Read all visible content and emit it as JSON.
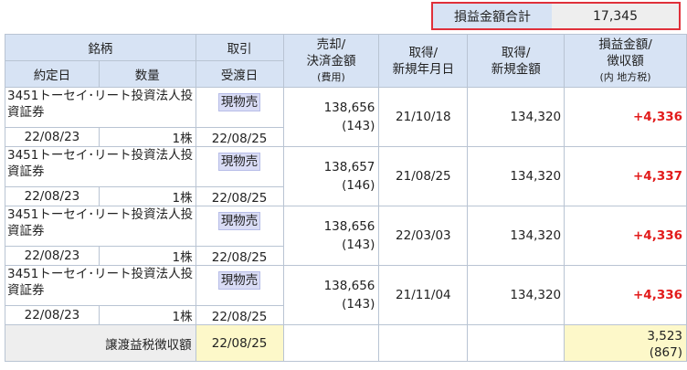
{
  "summary": {
    "label": "損益金額合計",
    "value": "17,345"
  },
  "headers": {
    "meigara": "銘柄",
    "torihiki": "取引",
    "baikyaku_1": "売却/",
    "baikyaku_2": "決済金額",
    "baikyaku_3": "(費用)",
    "shutoku_date_1": "取得/",
    "shutoku_date_2": "新規年月日",
    "shutoku_amt_1": "取得/",
    "shutoku_amt_2": "新規金額",
    "pl_1": "損益金額/",
    "pl_2": "徴収額",
    "pl_3": "(内 地方税)",
    "yakujo": "約定日",
    "suryo": "数量",
    "ukewatashi": "受渡日"
  },
  "rows": [
    {
      "name": "3451トーセイ･リート投資法人投資証券",
      "type": "現物売",
      "yakujo": "22/08/23",
      "qty": "1株",
      "ukewatashi": "22/08/25",
      "sale": "138,656",
      "fee": "(143)",
      "acq_date": "21/10/18",
      "acq_amt": "134,320",
      "pl": "+4,336"
    },
    {
      "name": "3451トーセイ･リート投資法人投資証券",
      "type": "現物売",
      "yakujo": "22/08/23",
      "qty": "1株",
      "ukewatashi": "22/08/25",
      "sale": "138,657",
      "fee": "(146)",
      "acq_date": "21/08/25",
      "acq_amt": "134,320",
      "pl": "+4,337"
    },
    {
      "name": "3451トーセイ･リート投資法人投資証券",
      "type": "現物売",
      "yakujo": "22/08/23",
      "qty": "1株",
      "ukewatashi": "22/08/25",
      "sale": "138,656",
      "fee": "(143)",
      "acq_date": "22/03/03",
      "acq_amt": "134,320",
      "pl": "+4,336"
    },
    {
      "name": "3451トーセイ･リート投資法人投資証券",
      "type": "現物売",
      "yakujo": "22/08/23",
      "qty": "1株",
      "ukewatashi": "22/08/25",
      "sale": "138,656",
      "fee": "(143)",
      "acq_date": "21/11/04",
      "acq_amt": "134,320",
      "pl": "+4,336"
    }
  ],
  "footer": {
    "label": "譲渡益税徴収額",
    "date": "22/08/25",
    "amount": "3,523",
    "local": "(867)"
  },
  "colors": {
    "header_bg": "#d7e3f4",
    "profit": "#e21b1b",
    "highlight_border": "#e0303a",
    "footer_yellow": "#fdf8c9"
  }
}
